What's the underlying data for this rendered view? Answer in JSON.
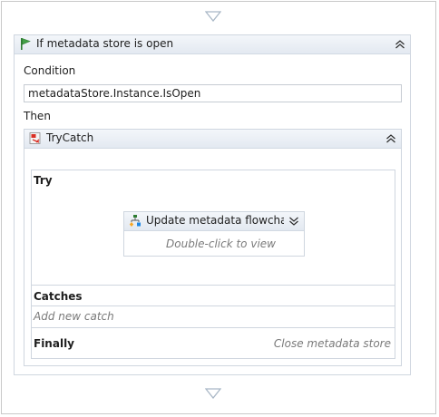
{
  "if_activity": {
    "title": "If metadata store is open",
    "condition_label": "Condition",
    "condition_value": "metadataStore.Instance.IsOpen",
    "then_label": "Then"
  },
  "trycatch_activity": {
    "title": "TryCatch",
    "try_label": "Try",
    "catches_label": "Catches",
    "add_catch_hint": "Add new catch",
    "finally_label": "Finally",
    "finally_content": "Close metadata store"
  },
  "flowchart_activity": {
    "title": "Update metadata flowchart",
    "hint": "Double-click to view"
  },
  "icons": {
    "if": "if-flag-icon",
    "trycatch": "trycatch-icon",
    "flowchart": "flowchart-icon",
    "collapse": "collapse-chevron-icon",
    "expand": "expand-chevron-icon",
    "drop_target": "drop-target-arrow-icon"
  },
  "colors": {
    "header_bg": "#e8edf3",
    "border": "#cfd6df",
    "hint_text": "#7a7a7a"
  }
}
